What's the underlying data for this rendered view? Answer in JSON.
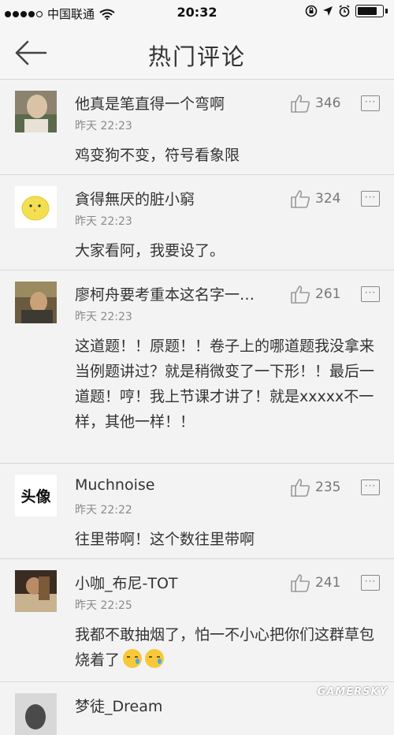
{
  "status_bar": {
    "carrier": "中国联通",
    "time": "20:32"
  },
  "header": {
    "title": "热门评论"
  },
  "comments": [
    {
      "username": "他真是笔直得一个弯啊",
      "time": "昨天 22:23",
      "likes": "346",
      "content": "鸡变狗不变，符号看象限",
      "avatar": "photo-avatar"
    },
    {
      "username": "貪得無厌的脏小窮",
      "time": "昨天 22:23",
      "likes": "324",
      "content": "大家看阿，我要设了。",
      "avatar": "yellow-chick-avatar"
    },
    {
      "username": "廖柯舟要考重本这名字一…",
      "time": "昨天 22:23",
      "likes": "261",
      "content": "这道题！！原题！！卷子上的哪道题我没拿来当例题讲过？就是稍微变了一下形！！最后一道题！哼！我上节课才讲了！就是xxxxx不一样，其他一样！！",
      "avatar": "photo-avatar"
    },
    {
      "username": "Muchnoise",
      "time": "昨天 22:22",
      "likes": "235",
      "content": "往里带啊！这个数往里带啊",
      "avatar": "text-avatar",
      "avatar_text": "头像"
    },
    {
      "username": "小咖_布尼-TOT",
      "time": "昨天 22:25",
      "likes": "241",
      "content": "我都不敢抽烟了，怕一不小心把你们这群草包烧着了",
      "avatar": "photo-avatar"
    },
    {
      "username": "梦徒_Dream",
      "time": "",
      "likes": "",
      "content": "",
      "avatar": "photo-avatar"
    }
  ],
  "watermark": "GAMERSKY",
  "colors": {
    "background": "#f3f3f3",
    "divider": "#d8d8d8",
    "text": "#333333",
    "secondary_text": "#8a8a8a"
  }
}
